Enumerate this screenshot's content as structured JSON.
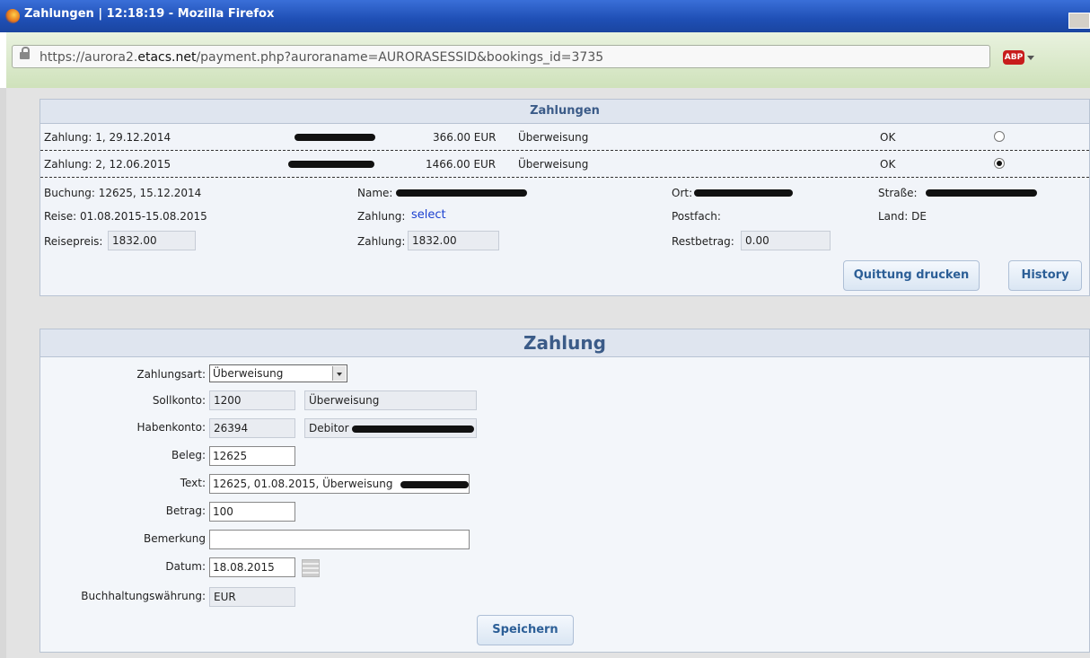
{
  "window": {
    "title": "Zahlungen | 12:18:19 - Mozilla Firefox"
  },
  "browser": {
    "url_prefix": "https://aurora2.",
    "url_host": "etacs.net",
    "url_path": "/payment.php?auroraname=AURORASESSID&bookings_id=3735",
    "adblock_label": "ABP"
  },
  "payments": {
    "title": "Zahlungen",
    "rows": [
      {
        "label": "Zahlung: 1, 29.12.2014",
        "amount": "366.00 EUR",
        "method": "Überweisung",
        "status": "OK",
        "selected": false
      },
      {
        "label": "Zahlung: 2, 12.06.2015",
        "amount": "1466.00 EUR",
        "method": "Überweisung",
        "status": "OK",
        "selected": true
      }
    ],
    "booking": "Buchung: 12625, 15.12.2014",
    "name_label": "Name:",
    "ort_label": "Ort:",
    "strasse_label": "Straße:",
    "reise": "Reise: 01.08.2015-15.08.2015",
    "zahlung_label": "Zahlung:",
    "zahlung_link": "select",
    "postfach_label": "Postfach:",
    "land": "Land: DE",
    "reisepreis_label": "Reisepreis:",
    "reisepreis_value": "1832.00",
    "zahlung_sum_label": "Zahlung:",
    "zahlung_sum_value": "1832.00",
    "restbetrag_label": "Restbetrag:",
    "restbetrag_value": "0.00",
    "print_button": "Quittung drucken",
    "history_button": "History"
  },
  "form": {
    "title": "Zahlung",
    "zahlungsart_label": "Zahlungsart:",
    "zahlungsart_value": "Überweisung",
    "sollkonto_label": "Sollkonto:",
    "sollkonto_value": "1200",
    "sollkonto_text": "Überweisung",
    "habenkonto_label": "Habenkonto:",
    "habenkonto_value": "26394",
    "habenkonto_text": "Debitor",
    "beleg_label": "Beleg:",
    "beleg_value": "12625",
    "text_label": "Text:",
    "text_value": "12625, 01.08.2015, Überweisung",
    "betrag_label": "Betrag:",
    "betrag_value": "100",
    "bemerkung_label": "Bemerkung",
    "bemerkung_value": "",
    "datum_label": "Datum:",
    "datum_value": "18.08.2015",
    "waehrung_label": "Buchhaltungswährung:",
    "waehrung_value": "EUR",
    "save_button": "Speichern"
  }
}
